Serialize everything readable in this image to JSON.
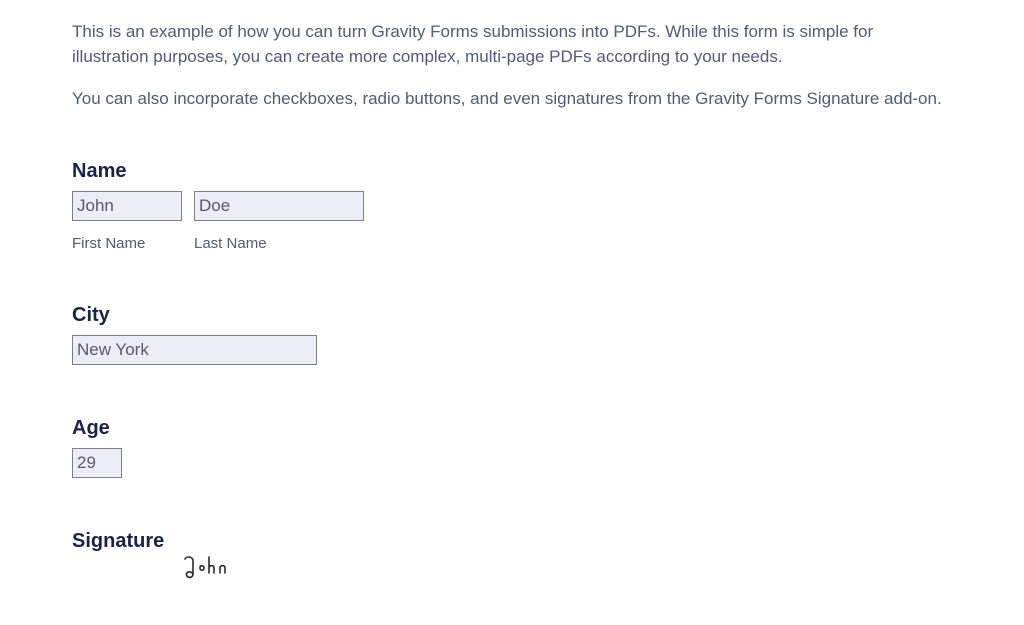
{
  "intro": {
    "paragraph1": "This is an example of how you can turn Gravity Forms submissions into PDFs. While this form is simple for illustration purposes, you can create more complex, multi-page PDFs according to your needs.",
    "paragraph2": "You can also incorporate checkboxes, radio buttons, and even signatures from the Gravity Forms Signature add-on."
  },
  "form": {
    "name": {
      "label": "Name",
      "first": {
        "value": "John",
        "sublabel": "First Name"
      },
      "last": {
        "value": "Doe",
        "sublabel": "Last Name"
      }
    },
    "city": {
      "label": "City",
      "value": "New York"
    },
    "age": {
      "label": "Age",
      "value": "29"
    },
    "signature": {
      "label": "Signature",
      "signed_text": "John"
    }
  }
}
